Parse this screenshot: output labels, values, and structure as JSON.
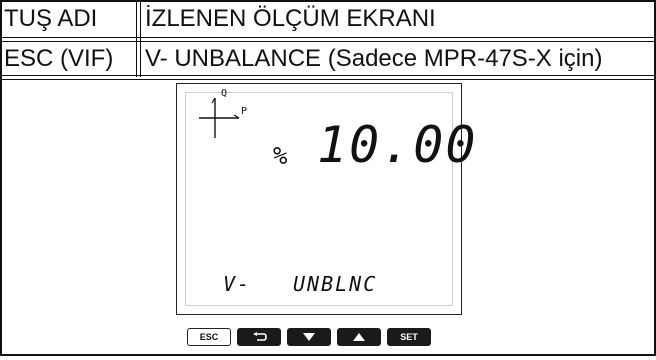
{
  "table": {
    "header": {
      "col1": "TUŞ ADI",
      "col2": "İZLENEN ÖLÇÜM EKRANI"
    },
    "row": {
      "col1": "ESC (VIF)",
      "col2": "V- UNBALANCE (Sadece MPR-47S-X için)"
    }
  },
  "lcd": {
    "axis_q": "Q",
    "axis_p": "P",
    "unit": "%",
    "value": "10.00",
    "label_left": "V-",
    "label_right": "UNBLNC"
  },
  "keys": {
    "esc": "ESC",
    "set": "SET",
    "icons": [
      "back-arrow-icon",
      "down-triangle-icon",
      "up-triangle-icon"
    ]
  }
}
